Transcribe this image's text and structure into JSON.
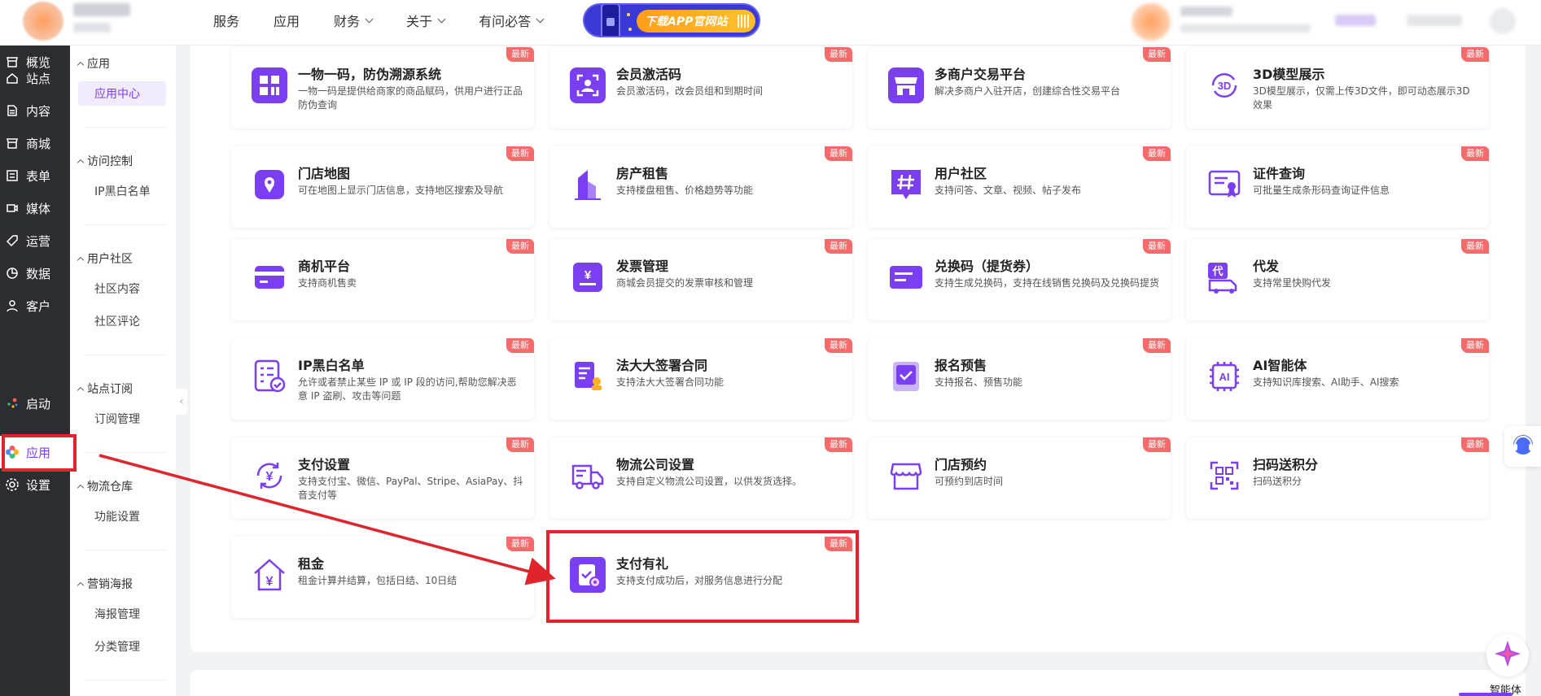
{
  "topnav": {
    "items": [
      {
        "label": "服务",
        "dropdown": false
      },
      {
        "label": "应用",
        "dropdown": false
      },
      {
        "label": "财务",
        "dropdown": true
      },
      {
        "label": "关于",
        "dropdown": true
      },
      {
        "label": "有问必答",
        "dropdown": true
      }
    ],
    "app_banner": "下载APP官网站"
  },
  "rail": {
    "items": [
      {
        "label": "概览",
        "icon": "shop-icon"
      },
      {
        "label": "站点",
        "icon": "home-icon"
      },
      {
        "label": "内容",
        "icon": "document-icon"
      },
      {
        "label": "商城",
        "icon": "store-icon"
      },
      {
        "label": "表单",
        "icon": "form-icon"
      },
      {
        "label": "媒体",
        "icon": "video-icon"
      },
      {
        "label": "运营",
        "icon": "tag-icon"
      },
      {
        "label": "数据",
        "icon": "pie-chart-icon"
      },
      {
        "label": "客户",
        "icon": "user-icon"
      }
    ],
    "bottom": [
      {
        "label": "启动",
        "icon": "launch-dots-icon"
      },
      {
        "label": "应用",
        "icon": "apps-flower-icon",
        "active": true
      },
      {
        "label": "设置",
        "icon": "gear-icon"
      }
    ]
  },
  "subside": {
    "groups": [
      {
        "title": "应用",
        "items": [
          "应用中心"
        ]
      },
      {
        "title": "访问控制",
        "items": [
          "IP黑白名单"
        ]
      },
      {
        "title": "用户社区",
        "items": [
          "社区内容",
          "社区评论"
        ]
      },
      {
        "title": "站点订阅",
        "items": [
          "订阅管理"
        ]
      },
      {
        "title": "物流仓库",
        "items": [
          "功能设置"
        ]
      },
      {
        "title": "营销海报",
        "items": [
          "海报管理",
          "分类管理"
        ]
      }
    ]
  },
  "cards": [
    {
      "title": "一物一码，防伪溯源系统",
      "desc": "一物一码是提供给商家的商品赋码，供用户进行正品防伪查询",
      "badge": "最新",
      "icon": "barcode-grid-icon"
    },
    {
      "title": "会员激活码",
      "desc": "会员激活码，改会员组和到期时间",
      "badge": "最新",
      "icon": "scan-user-icon"
    },
    {
      "title": "多商户交易平台",
      "desc": "解决多商户入驻开店，创建综合性交易平台",
      "badge": "最新",
      "icon": "storefront-icon"
    },
    {
      "title": "3D模型展示",
      "desc": "3D模型展示，仅需上传3D文件，即可动态展示3D效果",
      "badge": "最新",
      "icon": "3d-rotate-icon"
    },
    {
      "title": "门店地图",
      "desc": "可在地图上显示门店信息，支持地区搜索及导航",
      "badge": "最新",
      "icon": "map-pin-icon"
    },
    {
      "title": "房产租售",
      "desc": "支持楼盘租售、价格趋势等功能",
      "badge": "最新",
      "icon": "building-icon"
    },
    {
      "title": "用户社区",
      "desc": "支持问答、文章、视频、帖子发布",
      "badge": "最新",
      "icon": "hashtag-icon"
    },
    {
      "title": "证件查询",
      "desc": "可批量生成条形码查询证件信息",
      "badge": "最新",
      "icon": "certificate-icon"
    },
    {
      "title": "商机平台",
      "desc": "支持商机售卖",
      "badge": "最新",
      "icon": "card-icon"
    },
    {
      "title": "发票管理",
      "desc": "商城会员提交的发票审核和管理",
      "badge": "最新",
      "icon": "invoice-yen-icon"
    },
    {
      "title": "兑换码（提货券）",
      "desc": "支持生成兑换码，支持在线销售兑换码及兑换码提货",
      "badge": "最新",
      "icon": "voucher-icon"
    },
    {
      "title": "代发",
      "desc": "支持常里快购代发",
      "badge": "最新",
      "icon": "delivery-truck-icon"
    },
    {
      "title": "IP黑白名单",
      "desc": "允许或者禁止某些 IP 或 IP 段的访问,帮助您解决恶意 IP 盗刷、攻击等问题",
      "badge": "最新",
      "icon": "checklist-icon"
    },
    {
      "title": "法大大签署合同",
      "desc": "支持法大大签署合同功能",
      "badge": "最新",
      "icon": "contract-sign-icon"
    },
    {
      "title": "报名预售",
      "desc": "支持报名、预售功能",
      "badge": "最新",
      "icon": "signup-book-icon"
    },
    {
      "title": "AI智能体",
      "desc": "支持知识库搜索、AI助手、AI搜索",
      "badge": "最新",
      "icon": "ai-chip-icon"
    },
    {
      "title": "支付设置",
      "desc": "支持支付宝、微信、PayPal、Stripe、AsiaPay、抖音支付等",
      "badge": "最新",
      "icon": "yen-cycle-icon"
    },
    {
      "title": "物流公司设置",
      "desc": "支持自定义物流公司设置，以供发货选择。",
      "badge": "最新",
      "icon": "truck-icon"
    },
    {
      "title": "门店预约",
      "desc": "可预约到店时间",
      "badge": "最新",
      "icon": "shop-awning-icon"
    },
    {
      "title": "扫码送积分",
      "desc": "扫码送积分",
      "badge": "最新",
      "icon": "qr-scan-icon"
    },
    {
      "title": "租金",
      "desc": "租金计算并结算，包括日结、10日结",
      "badge": "最新",
      "icon": "house-yen-icon"
    },
    {
      "title": "支付有礼",
      "desc": "支持支付成功后，对服务信息进行分配",
      "badge": "最新",
      "icon": "pay-gift-icon"
    }
  ],
  "floating": {
    "agent_label": "智能体"
  },
  "colors": {
    "accent": "#7b3ff2",
    "badge": "#f46b6b",
    "highlight": "#e1242b",
    "rail": "#2b2d31"
  }
}
